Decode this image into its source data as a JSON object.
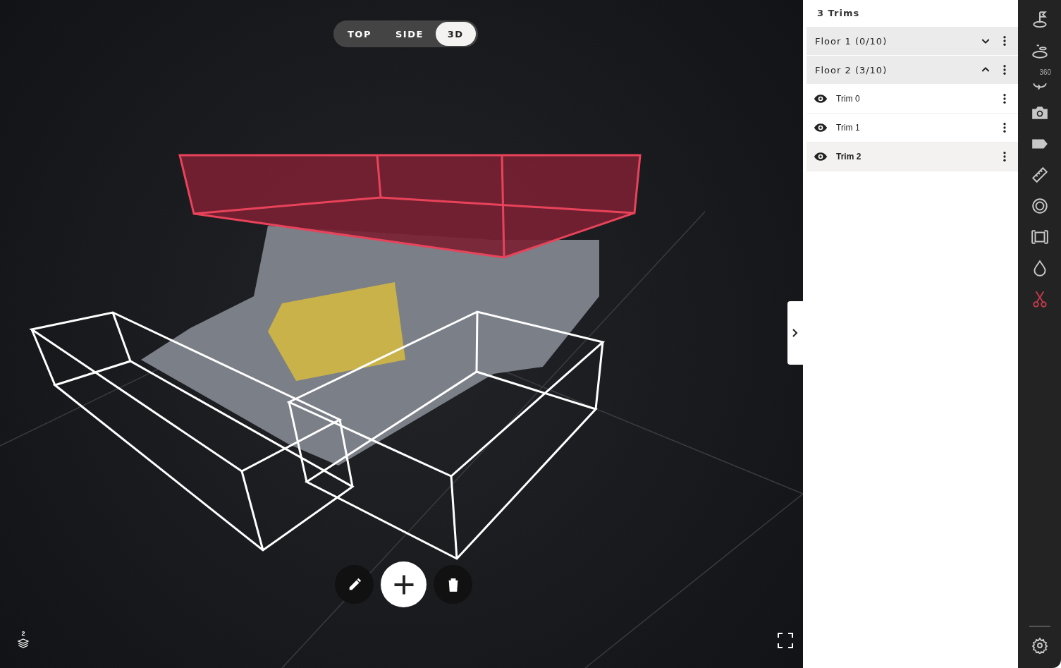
{
  "view_modes": [
    {
      "label": "TOP",
      "selected": false
    },
    {
      "label": "SIDE",
      "selected": false
    },
    {
      "label": "3D",
      "selected": true
    }
  ],
  "actions": [
    {
      "kind": "edit"
    },
    {
      "kind": "add"
    },
    {
      "kind": "delete"
    }
  ],
  "layers_button": {
    "badge": "2"
  },
  "panel": {
    "title": "3 Trims",
    "floors": [
      {
        "label": "Floor 1 (0/10)",
        "expanded": false
      },
      {
        "label": "Floor 2 (3/10)",
        "expanded": true,
        "trims": [
          {
            "label": "Trim 0",
            "visible": true,
            "selected": false
          },
          {
            "label": "Trim 1",
            "visible": true,
            "selected": false
          },
          {
            "label": "Trim 2",
            "visible": true,
            "selected": true
          }
        ]
      }
    ]
  },
  "tools": [
    {
      "kind": "flag",
      "selected": false
    },
    {
      "kind": "level",
      "selected": false
    },
    {
      "kind": "pano",
      "badge": "360",
      "selected": false
    },
    {
      "kind": "camera",
      "selected": false
    },
    {
      "kind": "tag",
      "selected": false
    },
    {
      "kind": "ruler",
      "selected": false
    },
    {
      "kind": "target",
      "selected": false
    },
    {
      "kind": "frame",
      "selected": false
    },
    {
      "kind": "drop",
      "selected": false
    },
    {
      "kind": "scissors",
      "selected": true
    }
  ]
}
